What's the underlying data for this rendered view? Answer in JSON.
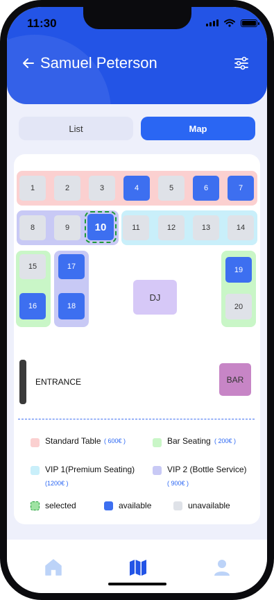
{
  "status_bar": {
    "time": "11:30"
  },
  "header": {
    "title": "Samuel Peterson"
  },
  "view_toggle": {
    "list_label": "List",
    "map_label": "Map"
  },
  "tables": {
    "t1": "1",
    "t2": "2",
    "t3": "3",
    "t4": "4",
    "t5": "5",
    "t6": "6",
    "t7": "7",
    "t8": "8",
    "t9": "9",
    "t10": "10",
    "t11": "11",
    "t12": "12",
    "t13": "13",
    "t14": "14",
    "t15": "15",
    "t16": "16",
    "t17": "17",
    "t18": "18",
    "t19": "19",
    "t20": "20"
  },
  "table_status": {
    "available": [
      "4",
      "6",
      "7",
      "16",
      "17",
      "18",
      "19"
    ],
    "selected": [
      "10"
    ],
    "unavailable": [
      "1",
      "2",
      "3",
      "5",
      "8",
      "9",
      "11",
      "12",
      "13",
      "14",
      "15",
      "20"
    ]
  },
  "floor": {
    "dj_label": "DJ",
    "entrance_label": "ENTRANCE",
    "bar_label": "BAR"
  },
  "legend": {
    "standard_label": "Standard Table",
    "standard_price": "( 600€ )",
    "bar_label": "Bar Seating",
    "bar_price": "( 200€ )",
    "vip1_label": "VIP 1(Premium Seating)",
    "vip1_price": "(1200€ )",
    "vip2_label": "VIP 2 (Bottle Service)",
    "vip2_price": "( 900€ )",
    "selected_label": "selected",
    "available_label": "available",
    "unavailable_label": "unavailable"
  },
  "colors": {
    "header": "#2354e6",
    "accent": "#2a66f3",
    "standard_zone": "#fbd0d0",
    "vip1_zone": "#c9effa",
    "vip2_zone": "#c8c9f5",
    "bar_zone": "#c9f6c7",
    "available": "#3d6ff0",
    "unavailable": "#dfe2e8",
    "selected_border": "#1d9a36"
  },
  "bottom_nav": {
    "items": [
      "home-icon",
      "map-icon",
      "profile-icon"
    ],
    "active": "map-icon"
  }
}
